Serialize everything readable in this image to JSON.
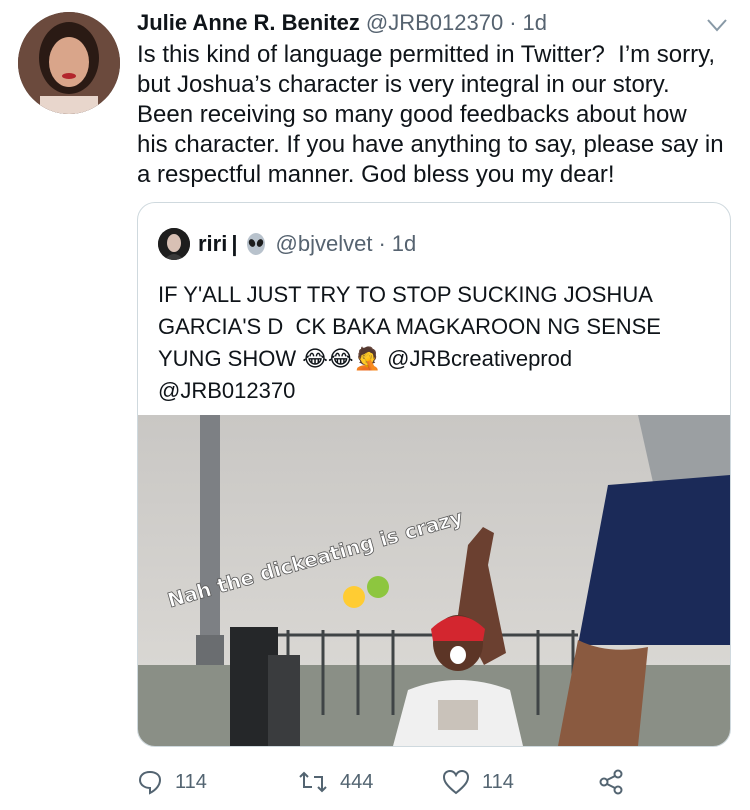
{
  "tweet": {
    "author_name": "Julie Anne R. Benitez",
    "handle": "@JRB012370",
    "separator": "·",
    "time": "1d",
    "text": "Is this kind of language permitted in Twitter?  I’m sorry,\nbut Joshua’s character is very integral in our story.\nBeen receiving so many good feedbacks about how\nhis character. If you have anything to say, please say in\na respectful manner. God bless you my dear!"
  },
  "quote": {
    "name": "riri",
    "name_separator": "|",
    "handle": "@bjvelvet",
    "separator": "·",
    "time": "1d",
    "text": "IF Y'ALL JUST TRY TO STOP SUCKING JOSHUA\nGARCIA'S D  CK BAKA MAGKAROON NG SENSE\nYUNG SHOW 😂😂🤦 @JRBcreativeprod\n@JRB012370",
    "image_caption": "Nah the dickeating is crazy"
  },
  "actions": {
    "reply_count": "114",
    "retweet_count": "444",
    "like_count": "114"
  },
  "colors": {
    "text": "#0f1419",
    "muted": "#536471",
    "border": "#cfd9de"
  },
  "icons": [
    "chevron-down-icon",
    "alien-emoji-icon",
    "reply-icon",
    "retweet-icon",
    "like-icon",
    "share-icon"
  ]
}
